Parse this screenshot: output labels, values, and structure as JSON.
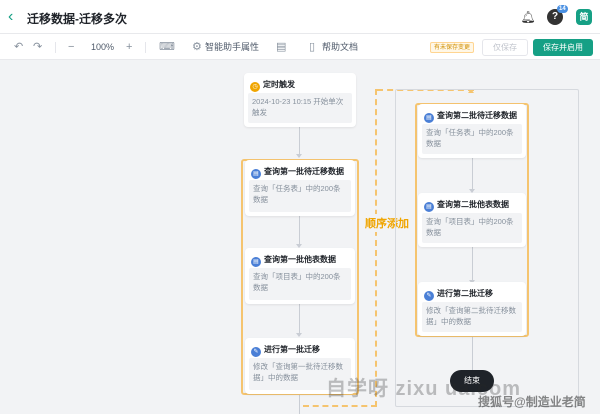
{
  "header": {
    "back_icon": "chevron-left-icon",
    "title": "迁移数据-迁移多次",
    "avatar_text": "简",
    "help_badge": "14"
  },
  "toolbar": {
    "zoom": "100%",
    "smart_assistant": "智能助手属性",
    "help_doc": "帮助文档",
    "unsaved_tag": "有未保存变更",
    "save_label": "仅保存",
    "enable_label": "保存并启用"
  },
  "flow": {
    "trigger": {
      "title": "定时触发",
      "desc": "2024-10-23 10:15 开始单次触发"
    },
    "left_nodes": [
      {
        "title": "查询第一批待迁移数据",
        "desc": "查询「任务表」中的200条数据"
      },
      {
        "title": "查询第一批他表数据",
        "desc": "查询「项目表」中的200条数据"
      },
      {
        "title": "进行第一批迁移",
        "desc": "修改「查询第一批待迁移数据」中的数据"
      }
    ],
    "right_nodes": [
      {
        "title": "查询第二批待迁移数据",
        "desc": "查询「任务表」中的200条数据"
      },
      {
        "title": "查询第二批他表数据",
        "desc": "查询「项目表」中的200条数据"
      },
      {
        "title": "进行第二批迁移",
        "desc": "修改「查询第二批待迁移数据」中的数据"
      }
    ],
    "sequence_label": "顺序添加",
    "end_label": "结束"
  },
  "watermark": {
    "line1": "自学呀  zixu  ua.com",
    "line2": "搜狐号@制造业老简"
  },
  "colors": {
    "accent": "#16a085",
    "group_border": "#f5c46f",
    "node_icon": "#4a7fd6"
  }
}
